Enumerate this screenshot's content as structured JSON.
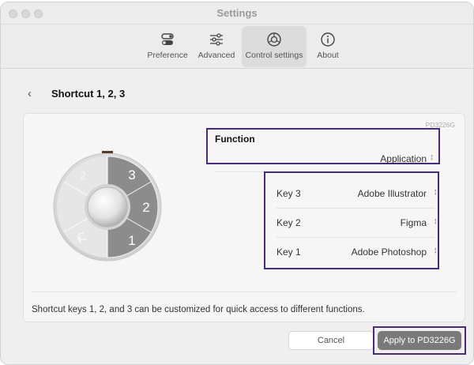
{
  "window": {
    "title": "Settings"
  },
  "toolbar": {
    "items": [
      {
        "label": "Preference",
        "icon": "toggle-icon"
      },
      {
        "label": "Advanced",
        "icon": "sliders-icon"
      },
      {
        "label": "Control settings",
        "icon": "dial-icon",
        "active": true
      },
      {
        "label": "About",
        "icon": "info-icon"
      }
    ]
  },
  "page": {
    "back_icon": "chevron-left-icon",
    "title": "Shortcut 1, 2, 3"
  },
  "device": {
    "model": "PD3226G",
    "dial_keys": [
      "3",
      "2",
      "1"
    ],
    "back_key_icon": "return-arrow-icon"
  },
  "function": {
    "label": "Function",
    "value": "Application"
  },
  "keys": [
    {
      "label": "Key 3",
      "value": "Adobe Illustrator"
    },
    {
      "label": "Key 2",
      "value": "Figma"
    },
    {
      "label": "Key 1",
      "value": "Adobe Photoshop"
    }
  ],
  "description": "Shortcut keys 1, 2, and 3 can be customized for quick access to different functions.",
  "buttons": {
    "cancel": "Cancel",
    "apply": "Apply to PD3226G"
  },
  "colors": {
    "highlight": "#4a2b7a",
    "apply_button": "#7a7a7a",
    "dial_key_active": "#8c8c8c",
    "dial_indicator": "#5a3a2a"
  }
}
